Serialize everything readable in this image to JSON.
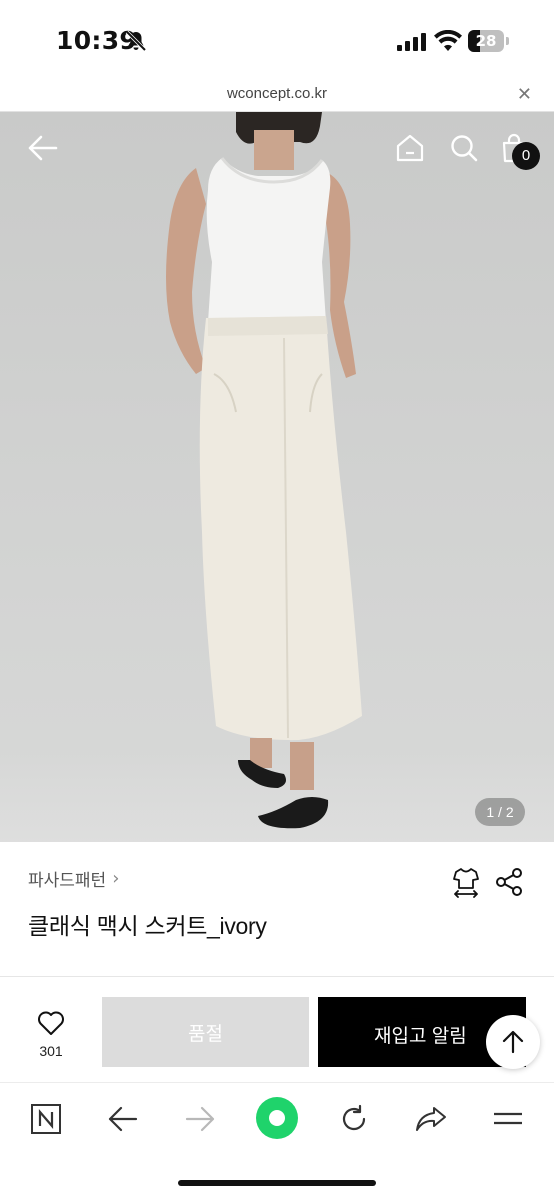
{
  "status_bar": {
    "time": "10:39",
    "battery_level": "28",
    "icons": [
      "bell-slash-icon",
      "cellular-signal-icon",
      "wifi-icon",
      "battery-icon"
    ]
  },
  "browser": {
    "url": "wconcept.co.kr",
    "toolbar_icons": [
      "naver-n-icon",
      "back-arrow-icon",
      "forward-arrow-icon",
      "naver-green-dot-icon",
      "reload-icon",
      "share-icon",
      "menu-icon"
    ]
  },
  "hero": {
    "cart_count": "0",
    "page_indicator": "1 / 2",
    "icons": [
      "back-arrow-icon",
      "home-icon",
      "search-icon",
      "shopping-bag-icon"
    ],
    "background_color": "#cfd0cf"
  },
  "product": {
    "brand": "파사드패턴",
    "brand_chevron": "›",
    "title": "클래식 맥시 스커트_ivory"
  },
  "purchase": {
    "like_count": "301",
    "soldout_label": "품절",
    "restock_label": "재입고 알림",
    "soldout_color": "#dcdcdc",
    "restock_color": "#000000"
  },
  "colors": {
    "accent_green": "#1fd36b"
  }
}
